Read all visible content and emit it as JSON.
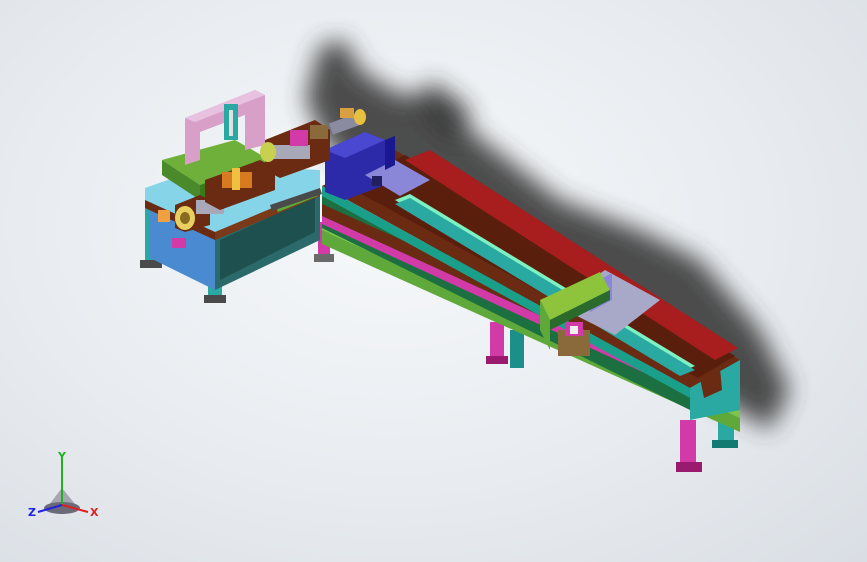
{
  "viewport": {
    "background_top": "#f6f8fa",
    "background_bottom": "#d9dee4"
  },
  "model": {
    "colors": {
      "frame_teal": "#2aa9a3",
      "frame_green": "#5fa83a",
      "bed_brown": "#6b2a12",
      "rail_red": "#a81d1d",
      "rail_mint": "#7ff0c0",
      "motor_blue": "#2c2aa8",
      "magenta": "#d23aa8",
      "purple_plate": "#8a86d8",
      "lime": "#8ec43b",
      "pink_frame": "#d8a0c8",
      "grey_plate": "#a8a8c8",
      "leg_teal": "#1c8f8a"
    }
  },
  "triad": {
    "x_label": "X",
    "y_label": "Y",
    "z_label": "Z",
    "x_color": "#e02020",
    "y_color": "#20b020",
    "z_color": "#2020e0"
  }
}
